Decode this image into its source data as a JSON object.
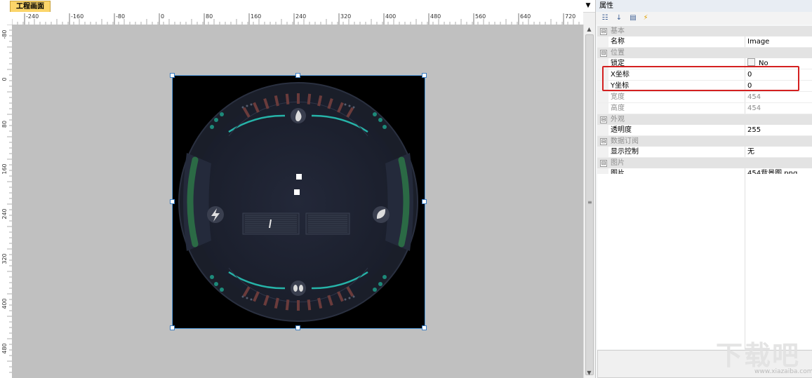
{
  "editor": {
    "tab_label": "工程画面",
    "tab_dropdown": "▼",
    "h_ruler_ticks": [
      "-240",
      "-160",
      "-80",
      "0",
      "80",
      "160",
      "240",
      "320",
      "400",
      "480",
      "560",
      "640",
      "720"
    ],
    "v_ruler_ticks": [
      "-80",
      "0",
      "80",
      "160",
      "240",
      "320",
      "400",
      "480"
    ],
    "scroll_up": "▲",
    "scroll_down": "▼",
    "scroll_grip": "≡"
  },
  "gauge_image": {
    "dial_markers": [
      ":",
      ":"
    ],
    "center_slot_label": "/"
  },
  "properties": {
    "title": "属性",
    "toolbar_icons": [
      "categorized-icon",
      "alphabetical-icon",
      "property-pages-icon",
      "events-icon"
    ],
    "toolbar_glyphs": [
      "☷",
      "↓",
      "▤",
      "⚡"
    ],
    "categories": [
      {
        "toggle": "⊟",
        "name": "基本",
        "rows": [
          {
            "name": "名称",
            "value": "Image",
            "dim": false
          }
        ]
      },
      {
        "toggle": "⊟",
        "name": "位置",
        "rows": [
          {
            "name": "锁定",
            "value": "No",
            "dim": false,
            "checkbox": true
          },
          {
            "name": "X坐标",
            "value": "0",
            "dim": false
          },
          {
            "name": "Y坐标",
            "value": "0",
            "dim": false
          },
          {
            "name": "宽度",
            "value": "454",
            "dim": true
          },
          {
            "name": "高度",
            "value": "454",
            "dim": true
          }
        ]
      },
      {
        "toggle": "⊟",
        "name": "外观",
        "rows": [
          {
            "name": "透明度",
            "value": "255",
            "dim": false
          }
        ]
      },
      {
        "toggle": "⊟",
        "name": "数据订阅",
        "rows": [
          {
            "name": "显示控制",
            "value": "无",
            "dim": false
          }
        ]
      },
      {
        "toggle": "⊟",
        "name": "图片",
        "rows": [
          {
            "name": "图片",
            "value": "454背景图.png",
            "dim": false
          }
        ]
      }
    ]
  },
  "watermark": {
    "text": "下载吧",
    "url": "www.xiazaiba.com"
  },
  "colors": {
    "highlight": "#d42020",
    "tab": "#fbd56a",
    "gauge_teal": "#26b3a8",
    "gauge_green": "#2b6a45",
    "gauge_body": "#1d2232"
  }
}
